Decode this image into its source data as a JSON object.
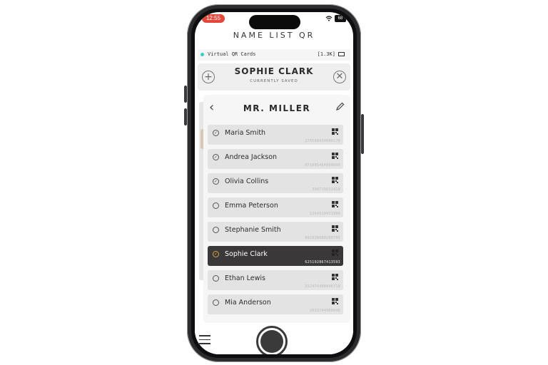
{
  "status_bar": {
    "time": "12:55",
    "battery": "68"
  },
  "app": {
    "title": "NAME LIST QR"
  },
  "info_bar": {
    "label": "Virtual QR Cards",
    "count": "[1.3K]"
  },
  "saved": {
    "name": "SOPHIE CLARK",
    "subtitle": "CURRENTLY SAVED"
  },
  "list": {
    "title": "MR. MILLER",
    "items": [
      {
        "name": "Maria Smith",
        "id": "276508434009170"
      },
      {
        "name": "Andrea Jackson",
        "id": "071005464888000"
      },
      {
        "name": "Olivia Collins",
        "id": "399715632410"
      },
      {
        "name": "Emma Peterson",
        "id": "1164510431904"
      },
      {
        "name": "Stephanie Smith",
        "id": "892828680200705"
      },
      {
        "name": "Sophie Clark",
        "id": "625102867413593"
      },
      {
        "name": "Ethan Lewis",
        "id": "312474408046710"
      },
      {
        "name": "Mia Anderson",
        "id": "2033744008046"
      }
    ]
  },
  "colors": {
    "accent": "#35d0c4",
    "selected": "#3a3838",
    "gold": "#d5a24a",
    "time_pill": "#e2473a"
  },
  "icons": [
    "plus-icon",
    "close-icon",
    "chevron-left-icon",
    "pencil-icon",
    "qr-code-icon",
    "check-icon",
    "circle-icon",
    "hamburger-menu-icon",
    "shutter-button"
  ]
}
